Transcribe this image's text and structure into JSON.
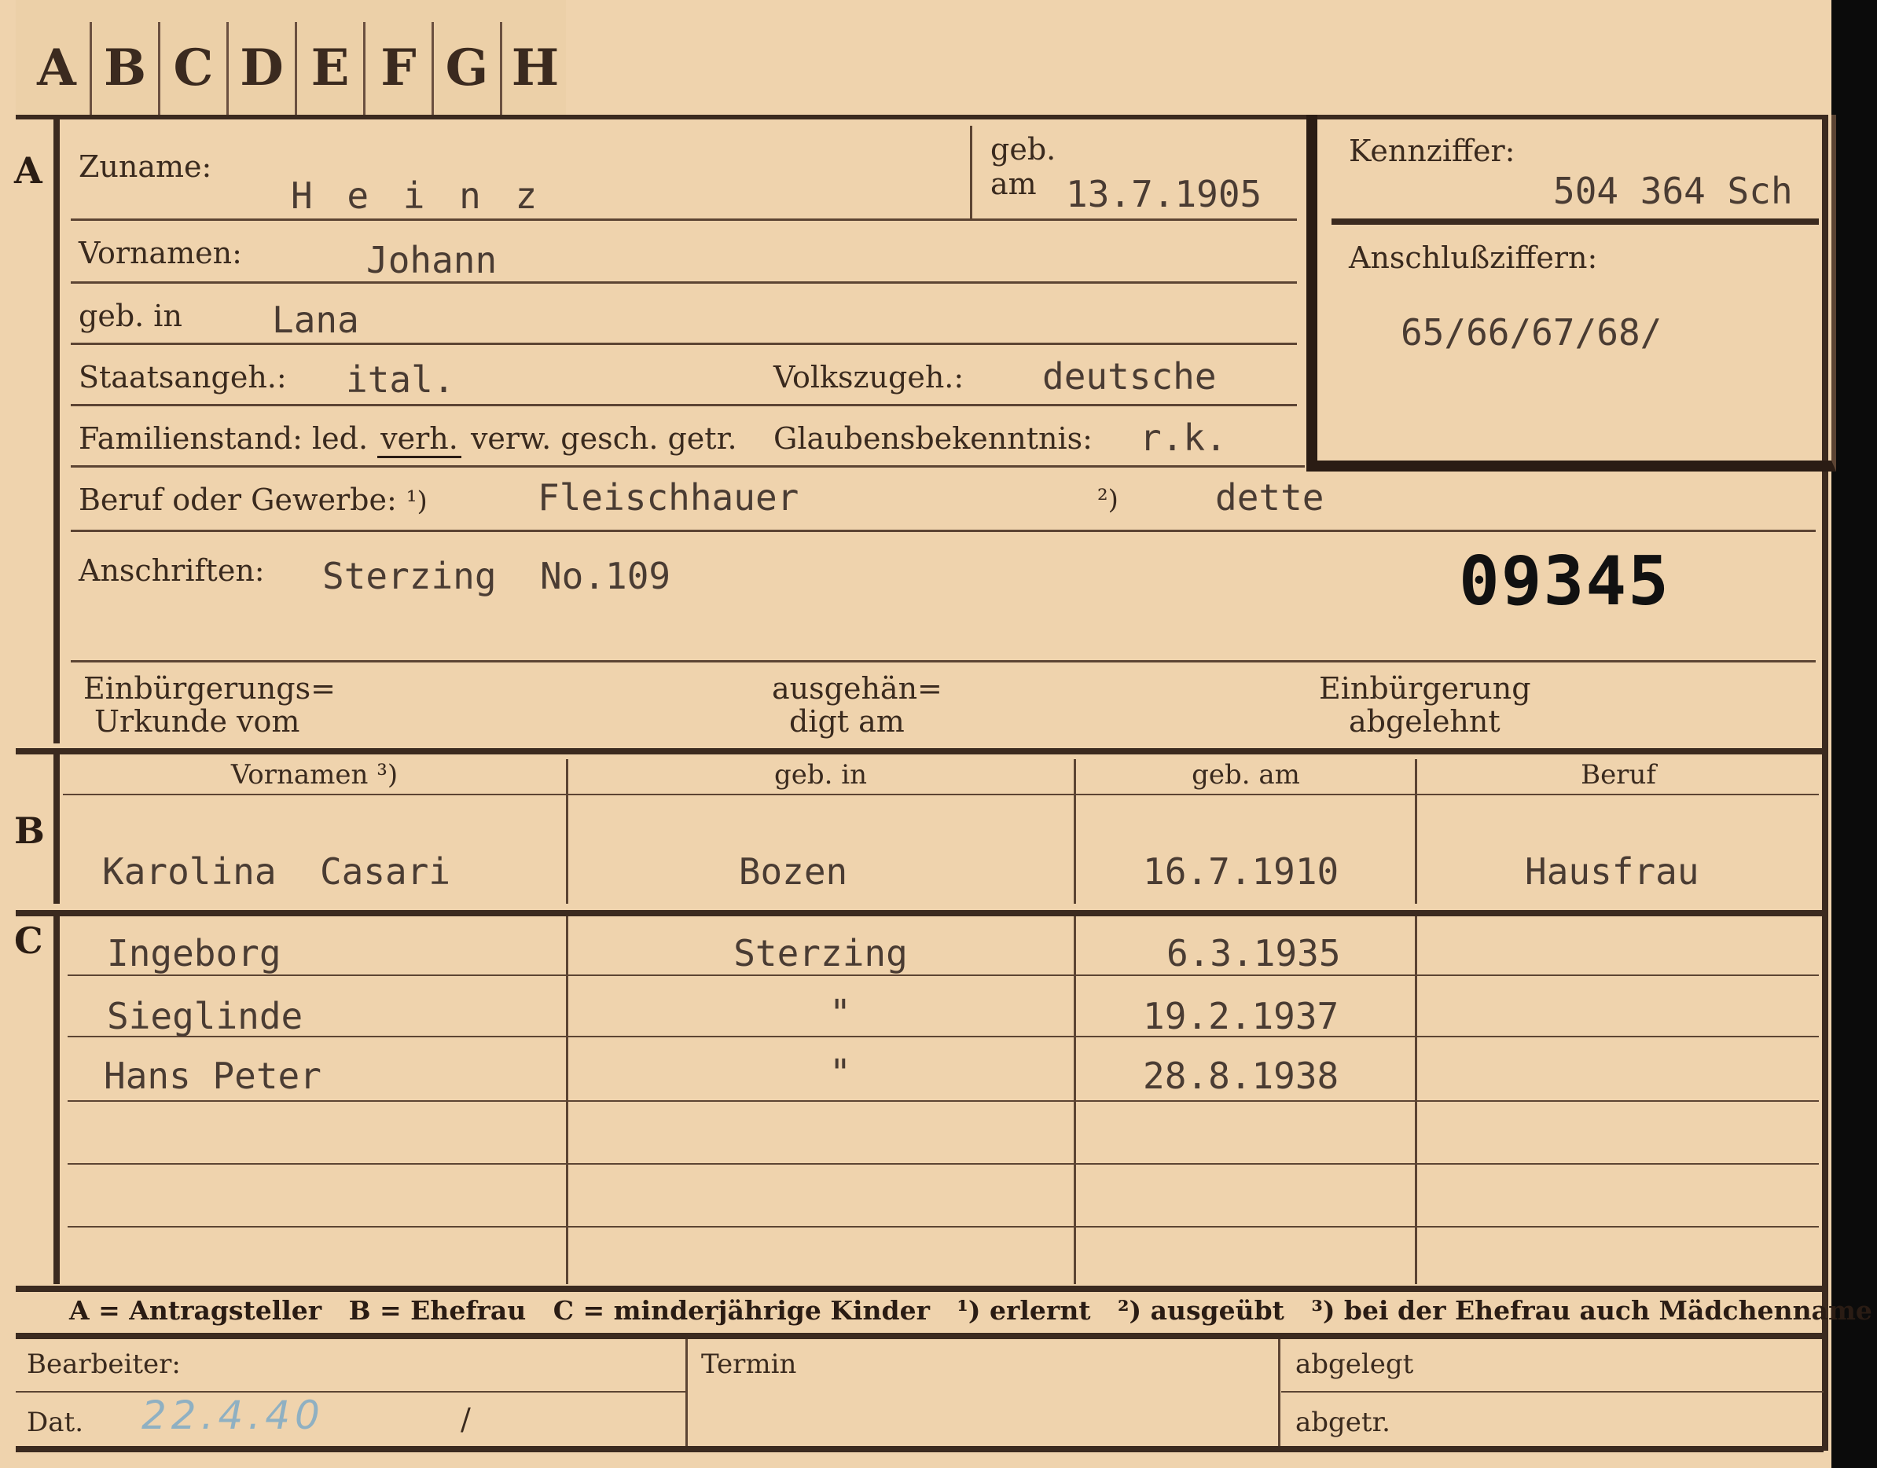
{
  "tabs": [
    "A",
    "B",
    "C",
    "D",
    "E",
    "F",
    "G",
    "H"
  ],
  "section_letters": {
    "a": "A",
    "b": "B",
    "c": "C"
  },
  "labels": {
    "zuname": "Zuname:",
    "geb": "geb.",
    "am": "am",
    "vornamen": "Vornamen:",
    "geb_in": "geb. in",
    "staatsangeh": "Staatsangeh.:",
    "volkszugeh": "Volkszugeh.:",
    "familienstand": "Familienstand:",
    "fam_led": "led.",
    "fam_verh": "verh.",
    "fam_rest": "verw. gesch. getr.",
    "glaubens": "Glaubensbekenntnis:",
    "beruf": "Beruf oder Gewerbe:",
    "beruf_note1": "¹)",
    "beruf_note2": "²)",
    "anschriften": "Anschriften:",
    "einb_urk_1": "Einbürgerungs=",
    "einb_urk_2": "Urkunde vom",
    "ausgeh_1": "ausgehän=",
    "ausgeh_2": "digt am",
    "einb_abg_1": "Einbürgerung",
    "einb_abg_2": "abgelehnt",
    "kennziffer": "Kennziffer:",
    "anschlussziffern": "Anschlußziffern:",
    "col_vornamen": "Vornamen ³)",
    "col_geb_in": "geb. in",
    "col_geb_am": "geb. am",
    "col_beruf": "Beruf",
    "bearbeiter": "Bearbeiter:",
    "dat": "Dat.",
    "termin": "Termin",
    "abgelegt": "abgelegt",
    "abgetr": "abgetr."
  },
  "applicant": {
    "zuname": "H e i n z",
    "geb_am": "13.7.1905",
    "vornamen": "Johann",
    "geb_in": "Lana",
    "staatsangeh": "ital.",
    "volkszugeh": "deutsche",
    "glaubens": "r.k.",
    "beruf_erlernt": "Fleischhauer",
    "beruf_ausgeuebt": "dette",
    "anschrift": "Sterzing  No.109",
    "stamp_number": "09345"
  },
  "kennziffer": "504 364  Sch",
  "anschlussziffern": "65/66/67/68/",
  "spouse": {
    "vornamen": "Karolina  Casari",
    "geb_in": "Bozen",
    "geb_am": "16.7.1910",
    "beruf": "Hausfrau"
  },
  "children": [
    {
      "vornamen": "Ingeborg",
      "geb_in": "Sterzing",
      "geb_am": "6.3.1935",
      "beruf": ""
    },
    {
      "vornamen": "Sieglinde",
      "geb_in": "\"",
      "geb_am": "19.2.1937",
      "beruf": ""
    },
    {
      "vornamen": "Hans Peter",
      "geb_in": "\"",
      "geb_am": "28.8.1938",
      "beruf": ""
    }
  ],
  "legend": "A = Antragsteller   B = Ehefrau   C = minderjährige Kinder   ¹) erlernt   ²) ausgeübt   ³) bei der Ehefrau auch Mädchenname",
  "footer": {
    "date_handwritten": "22.4.40",
    "slash": "/"
  }
}
